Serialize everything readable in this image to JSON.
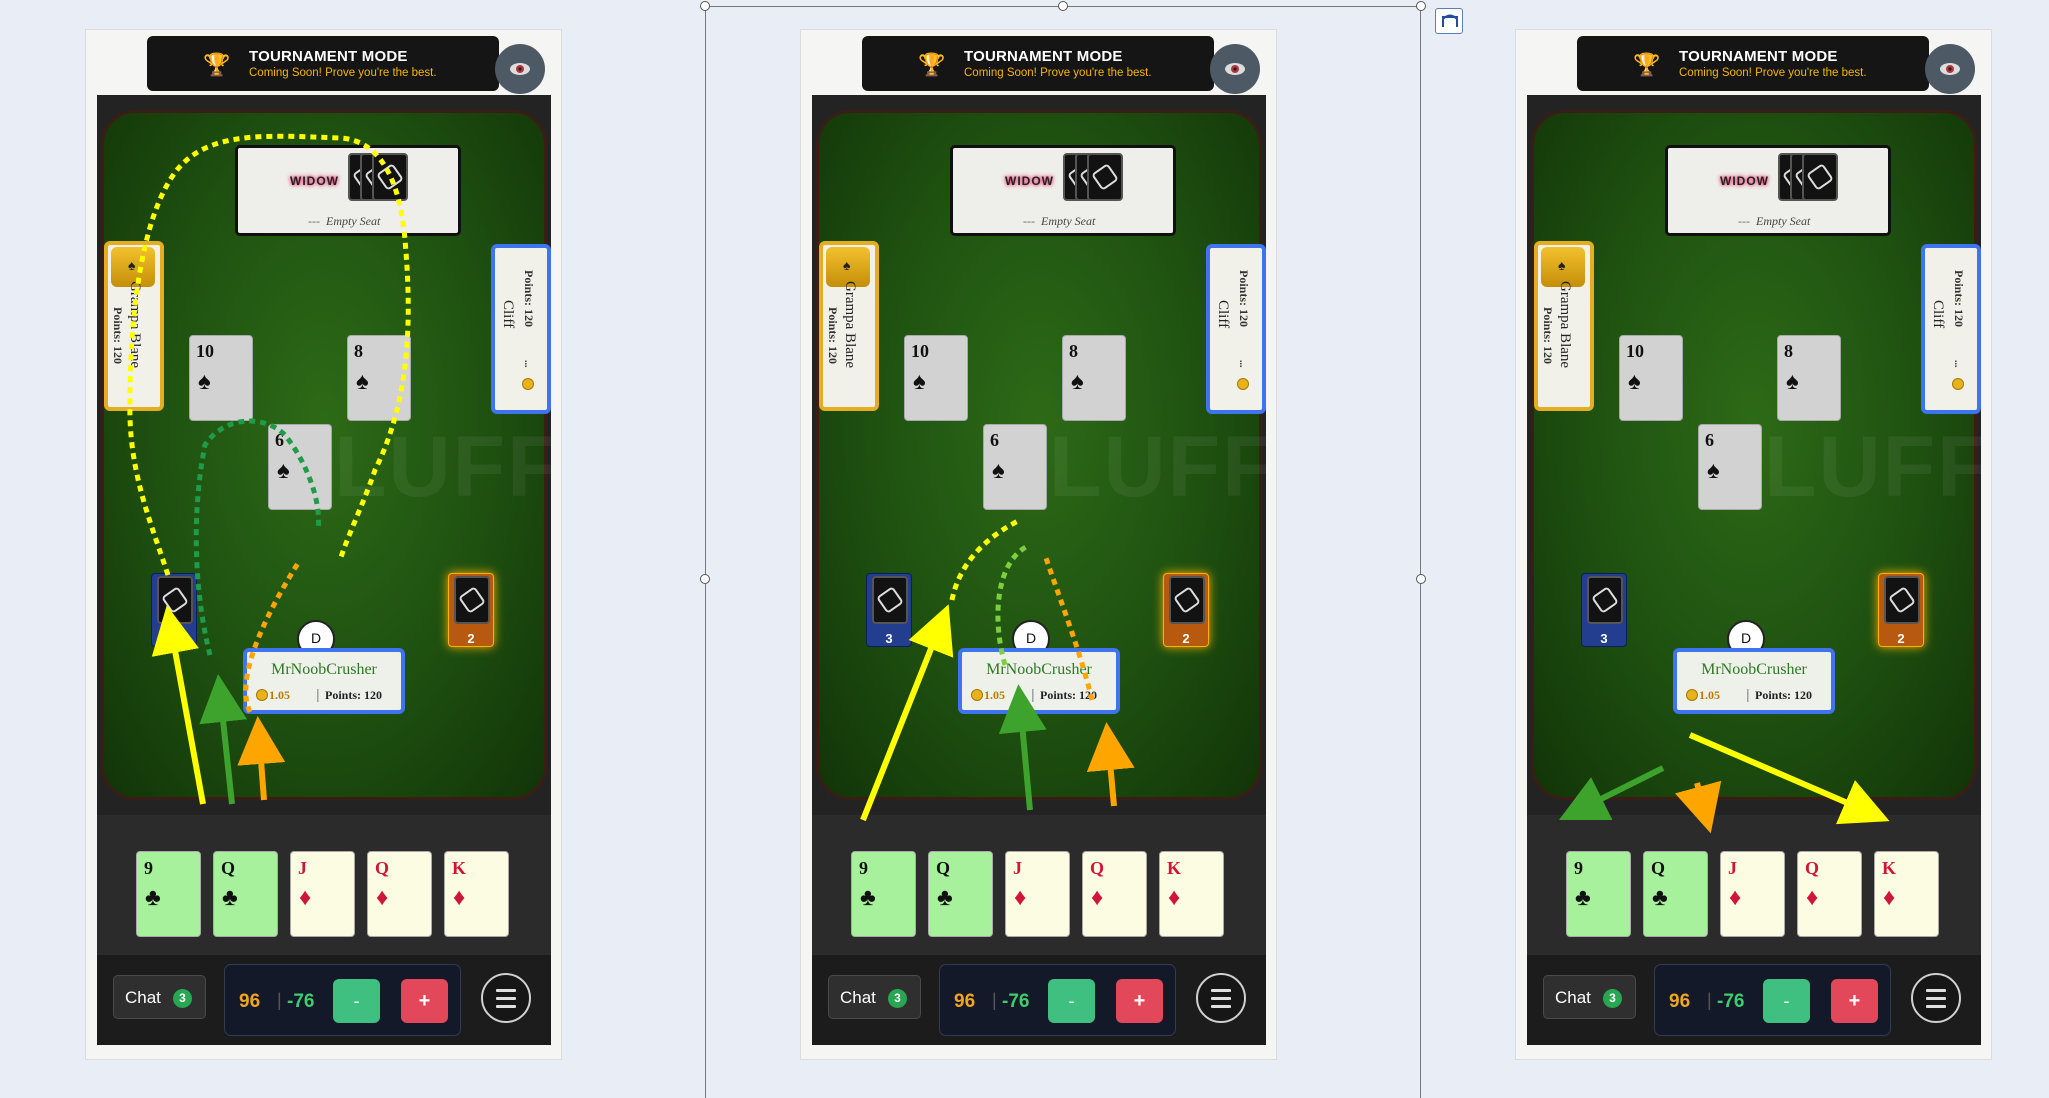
{
  "banner": {
    "title": "TOURNAMENT MODE",
    "subtitle": "Coming Soon! Prove you're the best.",
    "trophy": "🏆"
  },
  "widow": {
    "label": "WIDOW",
    "empty_seat": "Empty Seat",
    "dash": "---"
  },
  "seats": {
    "left": {
      "name": "Grampa Blane",
      "points": "Points: 120",
      "chip_icon": "♠"
    },
    "right": {
      "name": "Cliff",
      "points": "Points: 120",
      "coin_text": "..."
    }
  },
  "table_cards": [
    {
      "rank": "10",
      "suit": "♠"
    },
    {
      "rank": "8",
      "suit": "♠"
    },
    {
      "rank": "6",
      "suit": "♠"
    }
  ],
  "stacks": {
    "left_count": "3",
    "right_count": "2"
  },
  "dealer_label": "D",
  "player": {
    "name": "MrNoobCrusher",
    "money": "1.05",
    "points": "Points: 120"
  },
  "hand": [
    {
      "rank": "9",
      "suit": "♣",
      "color": "black",
      "highlight": true
    },
    {
      "rank": "Q",
      "suit": "♣",
      "color": "black",
      "highlight": true
    },
    {
      "rank": "J",
      "suit": "♦",
      "color": "red",
      "highlight": false
    },
    {
      "rank": "Q",
      "suit": "♦",
      "color": "red",
      "highlight": false
    },
    {
      "rank": "K",
      "suit": "♦",
      "color": "red",
      "highlight": false
    }
  ],
  "bottom": {
    "chat_label": "Chat",
    "chat_count": "3",
    "score": "96",
    "diff": "-76",
    "minus": "-",
    "plus": "+"
  },
  "colors": {
    "felt": "#1e5010",
    "highlight_card": "#a8f19c",
    "seat_blue": "#3f74f0",
    "seat_gold": "#e4ad22",
    "arrow_yellow": "#ffff00",
    "arrow_green": "#3da32c",
    "arrow_orange": "#ffa500"
  }
}
